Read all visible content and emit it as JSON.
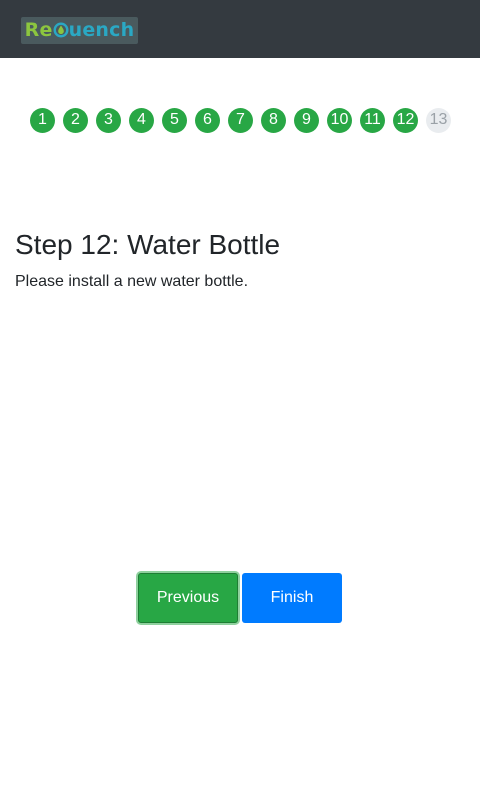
{
  "header": {
    "logo": {
      "text_prefix": "Re",
      "text_suffix": "uench",
      "icon": "water-drop-icon",
      "prefix_color": "#8cc63f",
      "suffix_color": "#2aa8c4"
    }
  },
  "steps": {
    "items": [
      {
        "label": "1",
        "state": "done"
      },
      {
        "label": "2",
        "state": "done"
      },
      {
        "label": "3",
        "state": "done"
      },
      {
        "label": "4",
        "state": "done"
      },
      {
        "label": "5",
        "state": "done"
      },
      {
        "label": "6",
        "state": "done"
      },
      {
        "label": "7",
        "state": "done"
      },
      {
        "label": "8",
        "state": "done"
      },
      {
        "label": "9",
        "state": "done"
      },
      {
        "label": "10",
        "state": "done"
      },
      {
        "label": "11",
        "state": "done"
      },
      {
        "label": "12",
        "state": "done"
      },
      {
        "label": "13",
        "state": "current"
      }
    ],
    "done_color": "#28a745",
    "current_color": "#e9ecef"
  },
  "content": {
    "title": "Step 12: Water Bottle",
    "description": "Please install a new water bottle."
  },
  "actions": {
    "previous_label": "Previous",
    "finish_label": "Finish",
    "previous_color": "#28a745",
    "finish_color": "#007bff"
  }
}
